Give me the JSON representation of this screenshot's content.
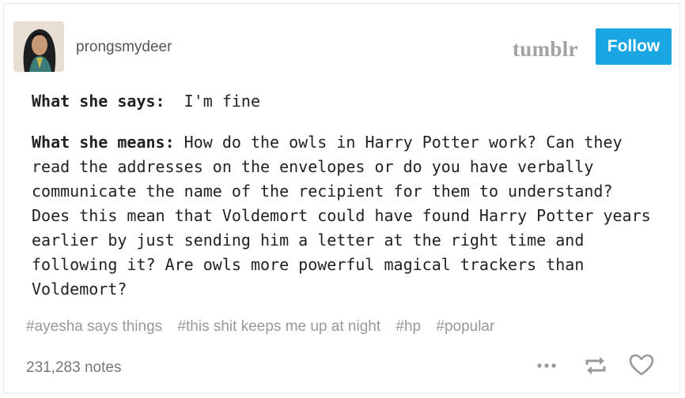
{
  "post": {
    "username": "prongsmydeer",
    "brand": "tumblr",
    "follow_label": "Follow",
    "says_label": "What she says:",
    "says_text": "I'm fine",
    "means_label": "What she means:",
    "means_text": "How do the owls in Harry Potter work? Can they read the addresses on the envelopes or do you have verbally communicate the name of the recipient for them to understand? Does this mean that Voldemort could have found Harry Potter years earlier by just sending him a letter at the right time and following it? Are owls more powerful magical trackers than Voldemort?",
    "tags": [
      "#ayesha says things",
      "#this shit keeps me up at night",
      "#hp",
      "#popular"
    ],
    "notes": "231,283 notes"
  },
  "icons": [
    "avatar",
    "more-icon",
    "reblog-icon",
    "heart-icon"
  ],
  "colors": {
    "follow_button": "#1aa5e3",
    "brand_logo": "#a3a3a3",
    "tags": "#999999",
    "icons": "#9a9a9a"
  }
}
